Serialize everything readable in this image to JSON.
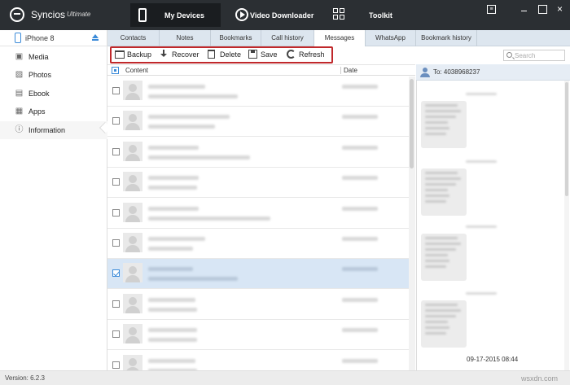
{
  "app": {
    "name": "Syncios",
    "edition": "Ultimate"
  },
  "top_tabs": [
    {
      "label": "My Devices",
      "icon": "phone-icon"
    },
    {
      "label": "Video Downloader",
      "icon": "play-icon"
    },
    {
      "label": "Toolkit",
      "icon": "grid-icon"
    }
  ],
  "window": {
    "menu_icon": "menu-icon",
    "minimize_icon": "minimize-icon",
    "maximize_icon": "maximize-icon",
    "close_icon": "close-icon"
  },
  "device": {
    "name": "iPhone 8"
  },
  "sidebar": {
    "items": [
      {
        "label": "Media",
        "icon": "media-icon",
        "glyph": "▣"
      },
      {
        "label": "Photos",
        "icon": "photos-icon",
        "glyph": "▨"
      },
      {
        "label": "Ebook",
        "icon": "ebook-icon",
        "glyph": "▤"
      },
      {
        "label": "Apps",
        "icon": "apps-icon",
        "glyph": "▦"
      },
      {
        "label": "Information",
        "icon": "info-icon",
        "glyph": "ⓘ",
        "active": true
      }
    ]
  },
  "sub_tabs": [
    "Contacts",
    "Notes",
    "Bookmarks",
    "Call history",
    "Messages",
    "WhatsApp",
    "Bookmark history"
  ],
  "active_sub_tab": "Messages",
  "toolbar": {
    "backup": "Backup",
    "recover": "Recover",
    "delete": "Delete",
    "save": "Save",
    "refresh": "Refresh"
  },
  "search": {
    "placeholder": "Search"
  },
  "list": {
    "col_content": "Content",
    "col_date": "Date",
    "row_count": 10,
    "selected_row": 6
  },
  "conversation": {
    "to": "To: 4038968237",
    "last_date": "09-17-2015 08:44"
  },
  "status": {
    "version": "Version: 6.2.3"
  },
  "watermark": "wsxdn.com",
  "colors": {
    "titlebar": "#2b2f33",
    "accent": "#3a8ad8",
    "highlight_border": "#c0282b",
    "subtab_bg": "#dde6ef"
  }
}
